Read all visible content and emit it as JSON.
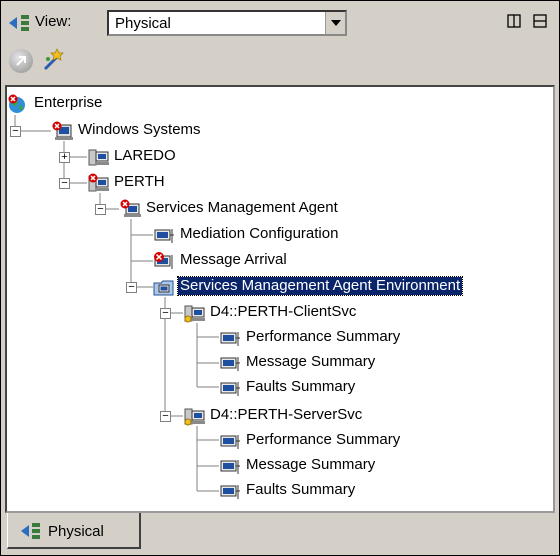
{
  "view": {
    "label": "View:",
    "selected": "Physical"
  },
  "tree": {
    "enterprise": "Enterprise",
    "windows_systems": "Windows Systems",
    "laredo": "LAREDO",
    "perth": "PERTH",
    "sma": "Services Management Agent",
    "mediation": "Mediation Configuration",
    "message_arrival": "Message Arrival",
    "sma_env": "Services Management Agent Environment",
    "client_svc": "D4::PERTH-ClientSvc",
    "client_perf": "Performance Summary",
    "client_msg": "Message Summary",
    "client_faults": "Faults Summary",
    "server_svc": "D4::PERTH-ServerSvc",
    "server_perf": "Performance Summary",
    "server_msg": "Message Summary",
    "server_faults": "Faults Summary"
  },
  "tabs": {
    "physical": "Physical"
  },
  "colors": {
    "selection": "#0a246a",
    "panel_bg": "#d4d0c8",
    "error_red": "#d40000"
  }
}
